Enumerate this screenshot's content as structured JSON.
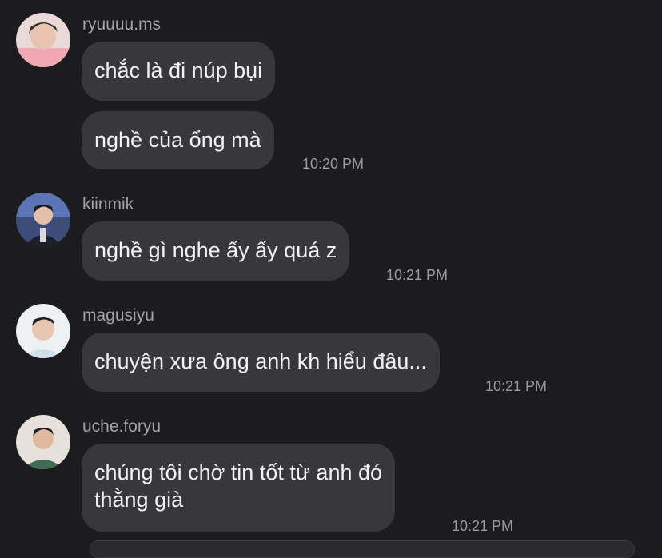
{
  "messages": [
    {
      "sender": "ryuuuu.ms",
      "avatar_icon": "avatar-ryuuuu-icon",
      "bubbles": [
        "chắc là đi núp bụi",
        "nghề của ổng mà"
      ],
      "time": "10:20 PM"
    },
    {
      "sender": "kiinmik",
      "avatar_icon": "avatar-kiinmik-icon",
      "bubbles": [
        "nghề gì nghe ấy ấy quá z"
      ],
      "time": "10:21 PM"
    },
    {
      "sender": "magusiyu",
      "avatar_icon": "avatar-magusiyu-icon",
      "bubbles": [
        "chuyện xưa ông anh kh hiểu đâu..."
      ],
      "time": "10:21 PM"
    },
    {
      "sender": "uche.foryu",
      "avatar_icon": "avatar-uche-icon",
      "bubbles": [
        "chúng tôi chờ tin tốt từ anh đó\nthằng già"
      ],
      "time": "10:21 PM"
    }
  ],
  "colors": {
    "background": "#1c1c1e",
    "bubble": "#38383a",
    "text": "#f2f2f4",
    "meta": "#9a9aa0"
  }
}
